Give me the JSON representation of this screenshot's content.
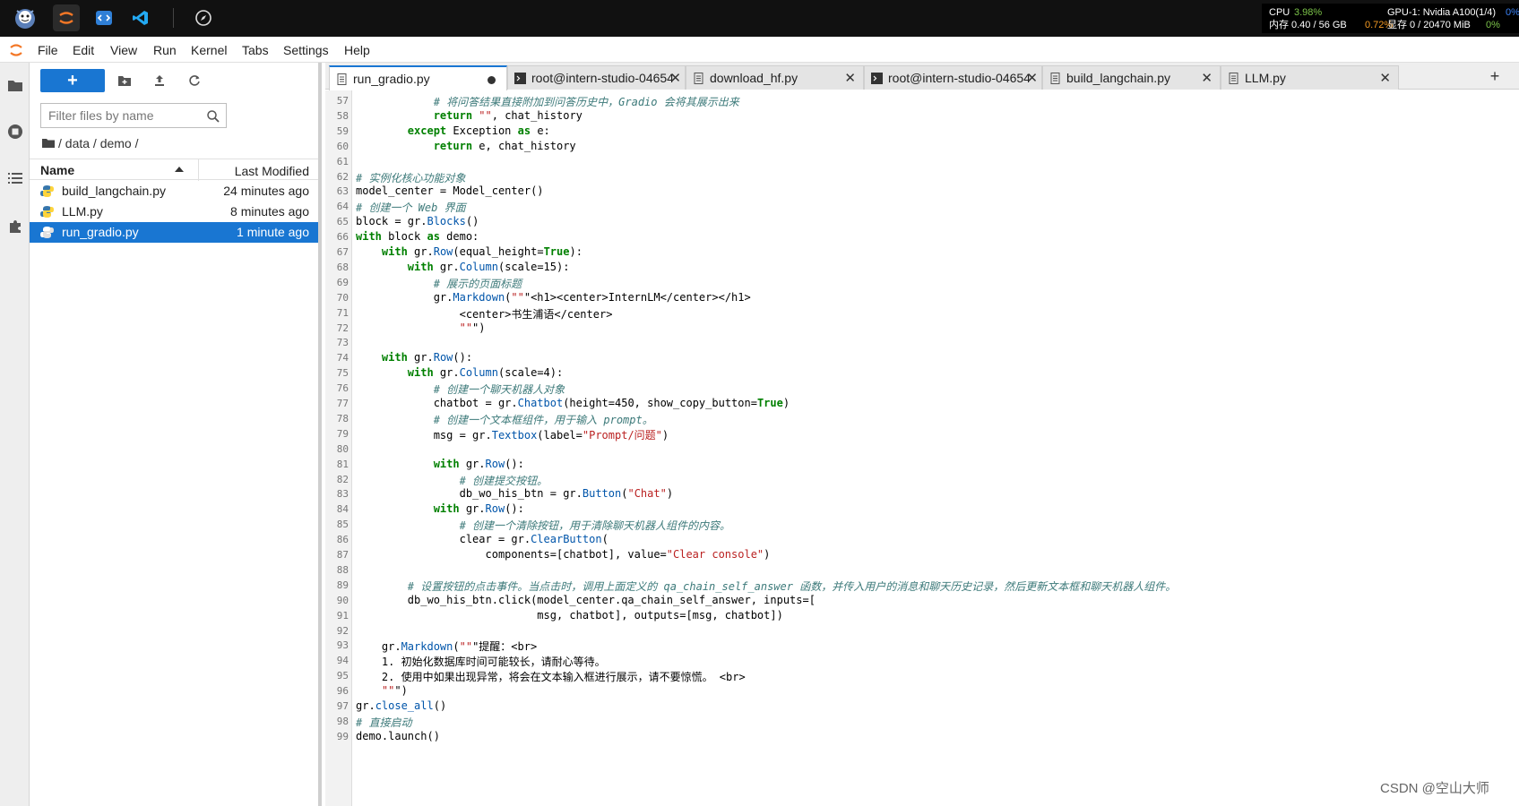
{
  "topbar": {
    "resources": {
      "cpu_label": "CPU",
      "cpu_value": "3.98%",
      "mem_label": "内存",
      "mem_value": "0.40 / 56 GB",
      "mem_percent": "0.72%",
      "gpu_label": "GPU-1: Nvidia A100(1/4)",
      "gpu_value": "0%",
      "vram_label": "显存",
      "vram_value": "0 / 20470 MiB",
      "vram_percent": "0%"
    }
  },
  "menu": {
    "items": [
      "File",
      "Edit",
      "View",
      "Run",
      "Kernel",
      "Tabs",
      "Settings",
      "Help"
    ]
  },
  "filebrowser": {
    "new_label": "+",
    "filter_placeholder": "Filter files by name",
    "breadcrumb": "/ data / demo /",
    "header_name": "Name",
    "header_modified": "Last Modified",
    "files": [
      {
        "name": "build_langchain.py",
        "modified": "24 minutes ago"
      },
      {
        "name": "LLM.py",
        "modified": "8 minutes ago"
      },
      {
        "name": "run_gradio.py",
        "modified": "1 minute ago"
      }
    ]
  },
  "tabs": [
    {
      "label": "run_gradio.py"
    },
    {
      "label": "root@intern-studio-04654"
    },
    {
      "label": "download_hf.py"
    },
    {
      "label": "root@intern-studio-04654"
    },
    {
      "label": "build_langchain.py"
    },
    {
      "label": "LLM.py"
    }
  ],
  "editor": {
    "line_numbers": [
      "57",
      "58",
      "59",
      "60",
      "61",
      "62",
      "63",
      "64",
      "65",
      "66",
      "67",
      "68",
      "69",
      "70",
      "71",
      "72",
      "73",
      "74",
      "75",
      "76",
      "77",
      "78",
      "79",
      "80",
      "81",
      "82",
      "83",
      "84",
      "85",
      "86",
      "87",
      "88",
      "89",
      "90",
      "91",
      "92",
      "93",
      "94",
      "95",
      "96",
      "97",
      "98",
      "99"
    ],
    "lines": [
      "            # 将问答结果直接附加到问答历史中，Gradio 会将其展示出来",
      "            return \"\", chat_history",
      "        except Exception as e:",
      "            return e, chat_history",
      "",
      "# 实例化核心功能对象",
      "model_center = Model_center()",
      "# 创建一个 Web 界面",
      "block = gr.Blocks()",
      "with block as demo:",
      "    with gr.Row(equal_height=True):",
      "        with gr.Column(scale=15):",
      "            # 展示的页面标题",
      "            gr.Markdown(\"\"\"<h1><center>InternLM</center></h1>",
      "                <center>书生浦语</center>",
      "                \"\"\")",
      "",
      "    with gr.Row():",
      "        with gr.Column(scale=4):",
      "            # 创建一个聊天机器人对象",
      "            chatbot = gr.Chatbot(height=450, show_copy_button=True)",
      "            # 创建一个文本框组件，用于输入 prompt。",
      "            msg = gr.Textbox(label=\"Prompt/问题\")",
      "",
      "            with gr.Row():",
      "                # 创建提交按钮。",
      "                db_wo_his_btn = gr.Button(\"Chat\")",
      "            with gr.Row():",
      "                # 创建一个清除按钮，用于清除聊天机器人组件的内容。",
      "                clear = gr.ClearButton(",
      "                    components=[chatbot], value=\"Clear console\")",
      "",
      "        # 设置按钮的点击事件。当点击时，调用上面定义的 qa_chain_self_answer 函数，并传入用户的消息和聊天历史记录，然后更新文本框和聊天机器人组件。",
      "        db_wo_his_btn.click(model_center.qa_chain_self_answer, inputs=[",
      "                            msg, chatbot], outputs=[msg, chatbot])",
      "",
      "    gr.Markdown(\"\"\"提醒：<br>",
      "    1. 初始化数据库时间可能较长，请耐心等待。",
      "    2. 使用中如果出现异常，将会在文本输入框进行展示，请不要惊慌。 <br>",
      "    \"\"\")",
      "gr.close_all()",
      "# 直接启动",
      "demo.launch()"
    ]
  },
  "watermark": "CSDN @空山大师",
  "colors": {
    "accent": "#1976d2",
    "topbar": "#111111",
    "comment": "#3d7a7a",
    "keyword": "#008000",
    "string": "#ba2121"
  }
}
